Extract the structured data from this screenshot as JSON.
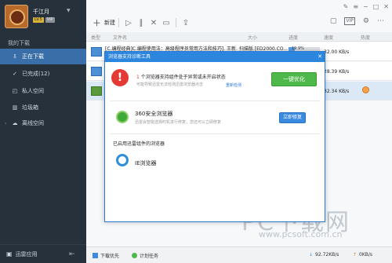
{
  "profile": {
    "username": "千江月",
    "level": "LV.5",
    "vip": "VIP"
  },
  "sidebar": {
    "title": "我的下载",
    "items": [
      {
        "label": "正在下载",
        "icon": "download-icon"
      },
      {
        "label": "已完成(12)",
        "icon": "check-circle-icon"
      },
      {
        "label": "私人空间",
        "icon": "private-space-icon"
      },
      {
        "label": "垃圾箱",
        "icon": "trash-icon"
      },
      {
        "label": "离线空间",
        "icon": "cloud-icon"
      }
    ],
    "bottom_label": "迅雷应用"
  },
  "toolbar": {
    "new_label": "新建"
  },
  "columns": {
    "type": "类型",
    "filename": "文件名",
    "size": "大小",
    "progress": "进度",
    "speed": "速度",
    "heat": "热度"
  },
  "downloads": [
    {
      "name": "[C.编程经典]C.编程使用法：高级程序员常用方法和技巧]. 王新. 扫描版.[ED2000.CO...",
      "progress_text": "19.9%",
      "progress": 0.199,
      "speed": "32.00 KB/s"
    },
    {
      "name": "",
      "progress_text": "",
      "progress": 0.0,
      "speed": "28.39 KB/s"
    },
    {
      "name": "",
      "progress_text": "",
      "progress": 0.0,
      "speed": "32.34 KB/s"
    }
  ],
  "statusbar": {
    "download_priority": "下载优先",
    "plan_task": "计划任务",
    "down_speed": "92.72KB/s",
    "up_speed": "0KB/s"
  },
  "dialog": {
    "title": "浏览器支持诊断工具",
    "warn_count": "1",
    "warn_title": "个浏览器支持组件处于异常或未开启状态",
    "warn_sub": "可能导致迅雷无法检测迅雷浏览器点击",
    "recheck_link": "重新检测",
    "optimize_button": "一键优化",
    "browser_360_name": "360安全浏览器",
    "browser_360_desc": "迅雷会智能选择时机进行修复，您还可以立即修复",
    "repair_button": "立即修复",
    "enabled_title": "已启用迅雷组件的浏览器",
    "ie_name": "IE浏览器"
  },
  "watermark": {
    "main": "PC下载网",
    "sub": "www.pcsoft.com.cn"
  }
}
